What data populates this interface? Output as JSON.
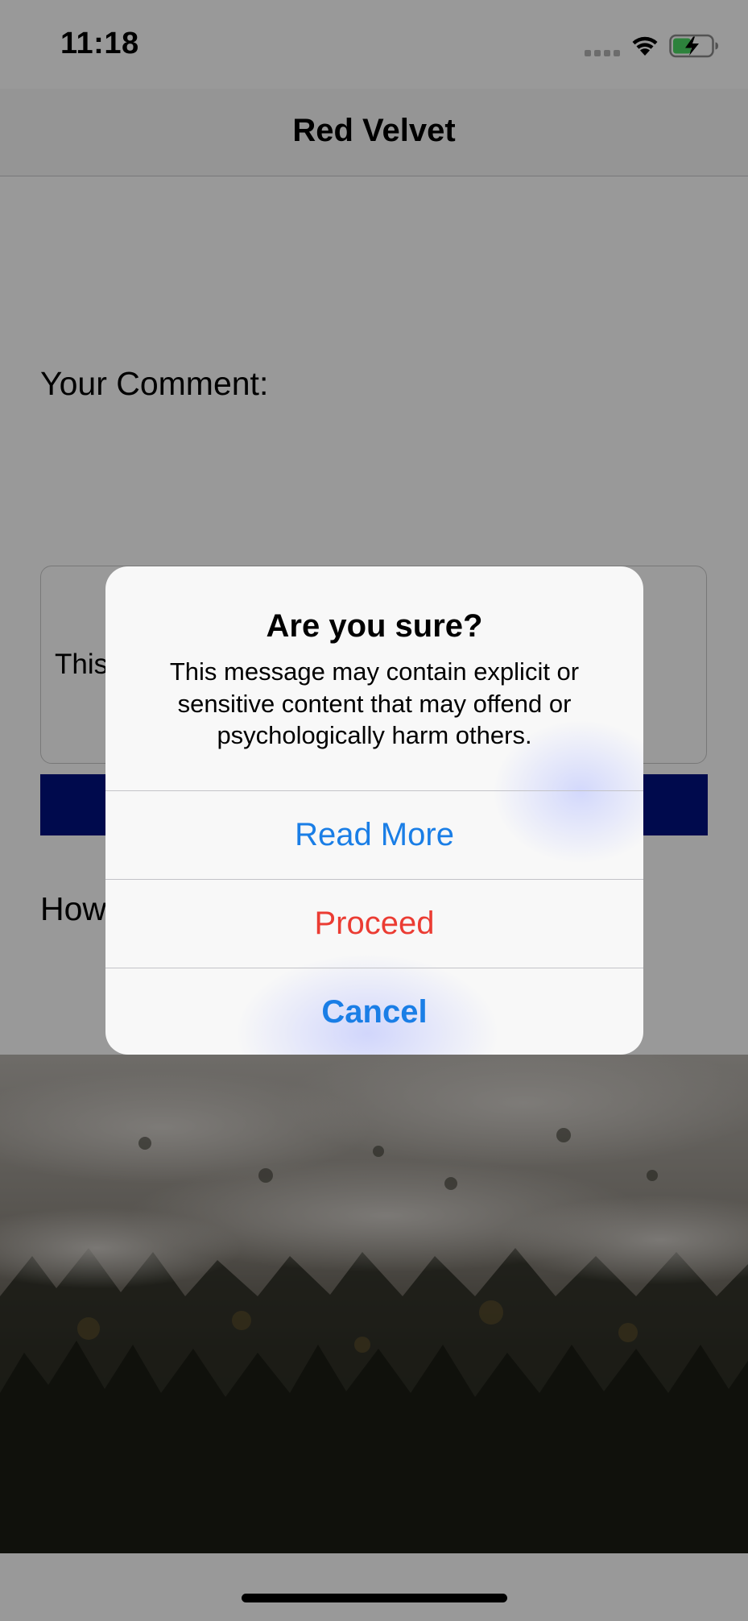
{
  "status_bar": {
    "time": "11:18"
  },
  "nav": {
    "title": "Red Velvet"
  },
  "form": {
    "comment_label": "Your Comment:",
    "comment_text_visible": "This",
    "how_label_visible": "How"
  },
  "alert": {
    "title": "Are you sure?",
    "message": "This message may contain explicit or sensitive content that may offend or psychologically harm others.",
    "buttons": {
      "read_more": "Read More",
      "proceed": "Proceed",
      "cancel": "Cancel"
    }
  },
  "colors": {
    "action_blue": "#1a7ee6",
    "destructive_red": "#eb3c33",
    "submit_button": "#011280",
    "battery_green": "#4cd964"
  },
  "icons": [
    "cellular-signal-icon",
    "wifi-icon",
    "battery-charging-icon"
  ]
}
